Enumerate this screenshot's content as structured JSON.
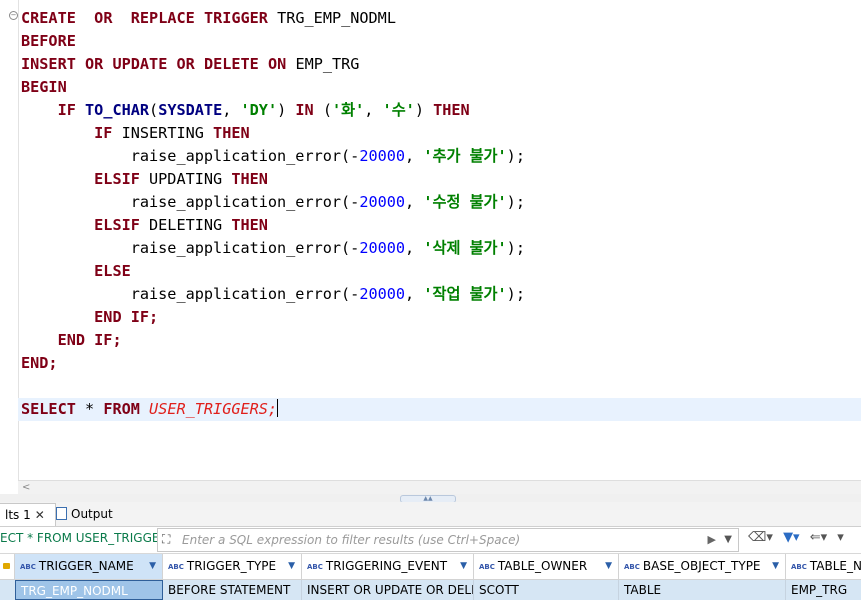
{
  "editor": {
    "lines": [
      [
        [
          "kw",
          "CREATE"
        ],
        [
          "",
          "  "
        ],
        [
          "kw",
          "OR"
        ],
        [
          "",
          "  "
        ],
        [
          "kw",
          "REPLACE"
        ],
        [
          "",
          " "
        ],
        [
          "kw",
          "TRIGGER"
        ],
        [
          "",
          " TRG_EMP_NODML"
        ]
      ],
      [
        [
          "kw",
          "BEFORE"
        ]
      ],
      [
        [
          "kw",
          "INSERT"
        ],
        [
          "",
          " "
        ],
        [
          "kw",
          "OR"
        ],
        [
          "",
          " "
        ],
        [
          "kw",
          "UPDATE"
        ],
        [
          "",
          " "
        ],
        [
          "kw",
          "OR"
        ],
        [
          "",
          " "
        ],
        [
          "kw",
          "DELETE"
        ],
        [
          "",
          " "
        ],
        [
          "kw",
          "ON"
        ],
        [
          "",
          " EMP_TRG"
        ]
      ],
      [
        [
          "kw",
          "BEGIN"
        ]
      ],
      [
        [
          "",
          "    "
        ],
        [
          "kw",
          "IF"
        ],
        [
          "",
          " "
        ],
        [
          "fn",
          "TO_CHAR"
        ],
        [
          "",
          "("
        ],
        [
          "fn",
          "SYSDATE"
        ],
        [
          "",
          ", "
        ],
        [
          "str",
          "'DY'"
        ],
        [
          ") ",
          ""
        ],
        [
          "kw",
          "IN"
        ],
        [
          "",
          " ("
        ],
        [
          "str",
          "'화'"
        ],
        [
          "",
          ", "
        ],
        [
          "str",
          "'수'"
        ],
        [
          "",
          ") "
        ],
        [
          "kw",
          "THEN"
        ]
      ],
      [
        [
          "",
          "        "
        ],
        [
          "kw",
          "IF"
        ],
        [
          "",
          " INSERTING "
        ],
        [
          "kw",
          "THEN"
        ]
      ],
      [
        [
          "",
          "            raise_application_error(-"
        ],
        [
          "num",
          "20000"
        ],
        [
          "",
          ", "
        ],
        [
          "str",
          "'추가 불가'"
        ],
        [
          "",
          ");"
        ]
      ],
      [
        [
          "",
          "        "
        ],
        [
          "kw",
          "ELSIF"
        ],
        [
          "",
          " UPDATING "
        ],
        [
          "kw",
          "THEN"
        ]
      ],
      [
        [
          "",
          "            raise_application_error(-"
        ],
        [
          "num",
          "20000"
        ],
        [
          "",
          ", "
        ],
        [
          "str",
          "'수정 불가'"
        ],
        [
          "",
          ");"
        ]
      ],
      [
        [
          "",
          "        "
        ],
        [
          "kw",
          "ELSIF"
        ],
        [
          "",
          " DELETING "
        ],
        [
          "kw",
          "THEN"
        ]
      ],
      [
        [
          "",
          "            raise_application_error(-"
        ],
        [
          "num",
          "20000"
        ],
        [
          "",
          ", "
        ],
        [
          "str",
          "'삭제 불가'"
        ],
        [
          "",
          ");"
        ]
      ],
      [
        [
          "",
          "        "
        ],
        [
          "kw",
          "ELSE"
        ]
      ],
      [
        [
          "",
          "            raise_application_error(-"
        ],
        [
          "num",
          "20000"
        ],
        [
          "",
          ", "
        ],
        [
          "str",
          "'작업 불가'"
        ],
        [
          "",
          ");"
        ]
      ],
      [
        [
          "",
          "        "
        ],
        [
          "kw",
          "END IF;"
        ]
      ],
      [
        [
          "",
          "    "
        ],
        [
          "kw",
          "END IF;"
        ]
      ],
      [
        [
          "kw",
          "END;"
        ]
      ],
      [],
      [
        [
          "kw",
          "SELECT"
        ],
        [
          "",
          " * "
        ],
        [
          "kw",
          "FROM"
        ],
        [
          "",
          " "
        ],
        [
          "tbl",
          "USER_TRIGGERS;"
        ]
      ]
    ]
  },
  "tabs": {
    "results_label": "lts 1",
    "close_glyph": "✕",
    "output_label": "Output"
  },
  "filter": {
    "query_text": "ECT * FROM USER_TRIGGERS",
    "placeholder": "Enter a SQL expression to filter results (use Ctrl+Space)"
  },
  "grid": {
    "columns": [
      "TRIGGER_NAME",
      "TRIGGER_TYPE",
      "TRIGGERING_EVENT",
      "TABLE_OWNER",
      "BASE_OBJECT_TYPE",
      "TABLE_NAME"
    ],
    "rows": [
      [
        "TRG_EMP_NODML",
        "BEFORE STATEMENT",
        "INSERT OR UPDATE OR DELETE",
        "SCOTT",
        "TABLE",
        "EMP_TRG"
      ]
    ]
  },
  "icons": [
    "fold-icon",
    "document-icon",
    "filter-icon",
    "play-icon",
    "dropdown-icon",
    "eraser-icon",
    "funnel-icon",
    "back-arrow-icon",
    "lock-icon"
  ]
}
